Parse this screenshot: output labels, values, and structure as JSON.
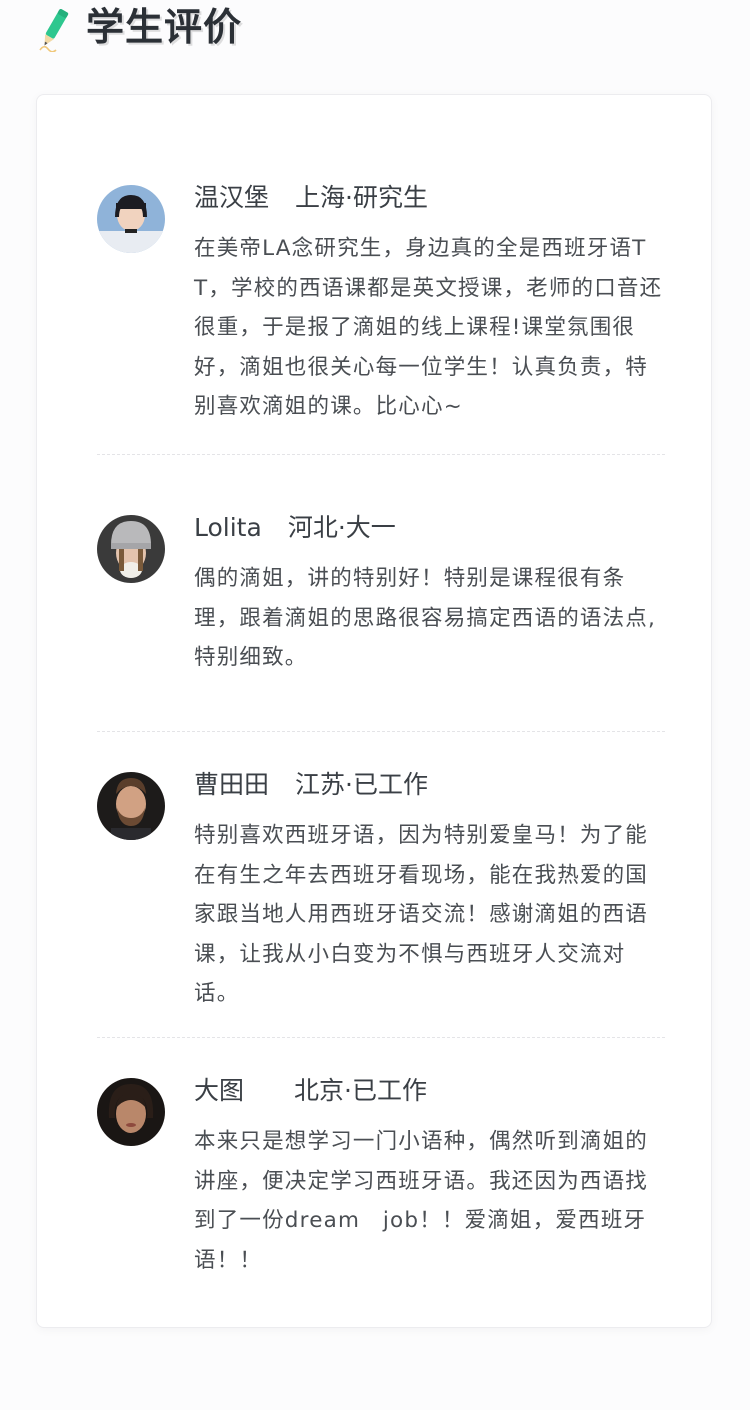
{
  "header": {
    "title": "学生评价",
    "icon": "pencil-icon",
    "accent": "#2ec78f"
  },
  "reviews": [
    {
      "name": "温汉堡",
      "location": "上海·研究生",
      "text": "在美帝LA念研究生，身边真的全是西班牙语TT，学校的西语课都是英文授课，老师的口音还很重，于是报了滴姐的线上课程!课堂氛围很好，滴姐也很关心每一位学生！认真负责，特别喜欢滴姐的课。比心心~"
    },
    {
      "name": "Lolita",
      "location": "河北·大一",
      "text": "偶的滴姐，讲的特别好！特别是课程很有条理，跟着滴姐的思路很容易搞定西语的语法点, 特别细致。"
    },
    {
      "name": "曹田田",
      "location": "江苏·已工作",
      "text": "特别喜欢西班牙语，因为特别爱皇马！为了能在有生之年去西班牙看现场，能在我热爱的国家跟当地人用西班牙语交流！感谢滴姐的西语课，让我从小白变为不惧与西班牙人交流对话。"
    },
    {
      "name": "大图",
      "location": "北京·已工作",
      "text": "本来只是想学习一门小语种，偶然听到滴姐的讲座，便决定学习西班牙语。我还因为西语找到了一份dream　job！！爱滴姐，爱西班牙语！！"
    }
  ]
}
